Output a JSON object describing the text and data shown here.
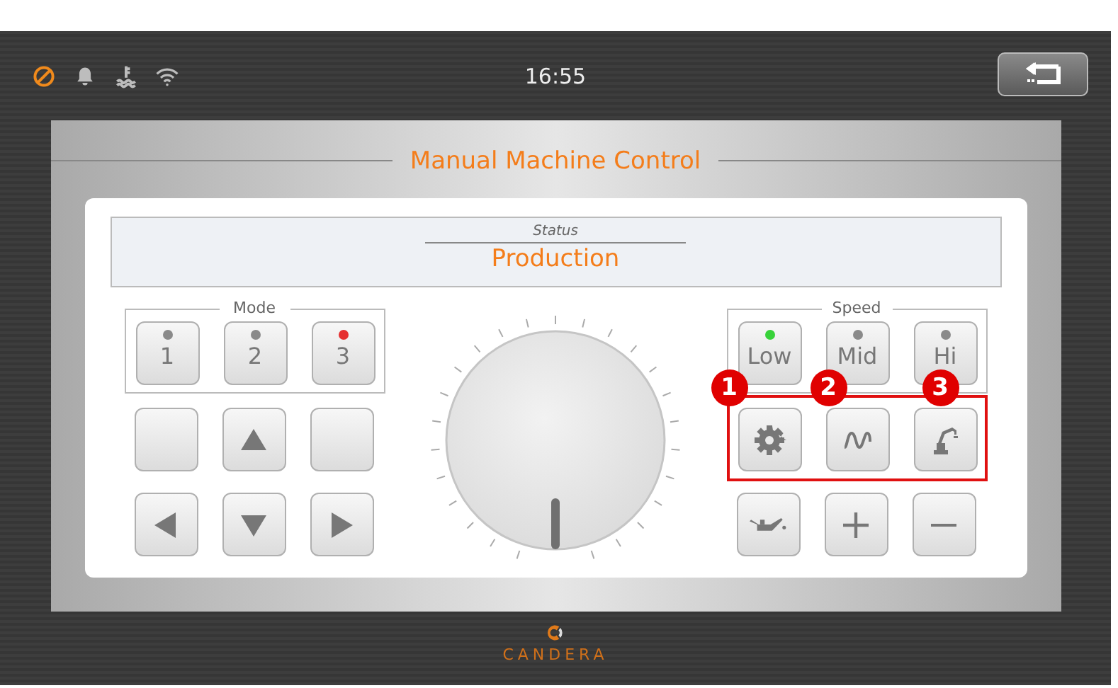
{
  "status_bar": {
    "icons": [
      {
        "kind": "blocked",
        "color": "#f08a1c"
      },
      {
        "kind": "bell",
        "color": "#bdbdbd"
      },
      {
        "kind": "coolant",
        "color": "#bdbdbd"
      },
      {
        "kind": "wifi",
        "color": "#bdbdbd"
      }
    ],
    "time": "16:55"
  },
  "back_button": {
    "kind": "back"
  },
  "title": "Manual Machine Control",
  "status": {
    "label": "Status",
    "value": "Production"
  },
  "mode": {
    "label": "Mode",
    "buttons": [
      {
        "label": "1",
        "color": "#8a8a8a"
      },
      {
        "label": "2",
        "color": "#8a8a8a"
      },
      {
        "label": "3",
        "color": "#e53030"
      }
    ]
  },
  "arrows": [
    {
      "kind": "blank"
    },
    {
      "kind": "up"
    },
    {
      "kind": "blank"
    },
    {
      "kind": "left"
    },
    {
      "kind": "down"
    },
    {
      "kind": "right"
    }
  ],
  "speed": {
    "label": "Speed",
    "buttons": [
      {
        "label": "Low",
        "color": "#38d23a"
      },
      {
        "label": "Mid",
        "color": "#8a8a8a"
      },
      {
        "label": "Hi",
        "color": "#8a8a8a"
      }
    ]
  },
  "tools": [
    {
      "kind": "gear",
      "callout": "1"
    },
    {
      "kind": "wave",
      "callout": "2"
    },
    {
      "kind": "robot",
      "callout": "3"
    }
  ],
  "actions": [
    {
      "kind": "oil"
    },
    {
      "kind": "plus"
    },
    {
      "kind": "minus"
    }
  ],
  "brand": "CANDERA"
}
